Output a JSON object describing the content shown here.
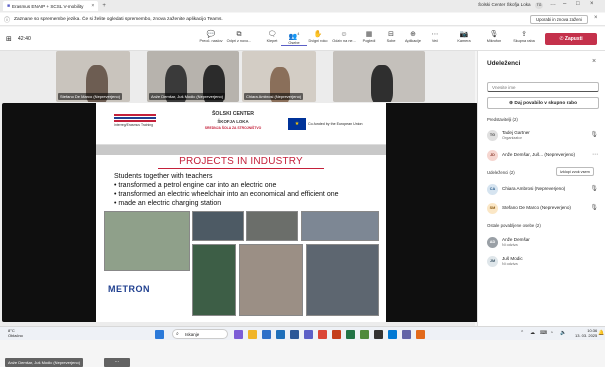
{
  "window": {
    "tab_title": "Erasmus ENAIP + SCSL V-mobility",
    "center_title": "Šolski Center Škofja Loka",
    "user_initials": "TG"
  },
  "notification": {
    "text": "Zaznane so spremembe jezika. Če si želite ogledati spremembo, znova zaženite aplikacijo Teams.",
    "button_label": "Uporabi in znova zaženi"
  },
  "toolbar": {
    "timer": "42:40",
    "buttons": [
      {
        "label": "Preoč. naslov",
        "icon": "chat-icon"
      },
      {
        "label": "Odpri z novo...",
        "icon": "window-icon"
      },
      {
        "label": "Klepet",
        "icon": "chat-bubble-icon"
      },
      {
        "label": "Osebe",
        "icon": "people-icon",
        "count": "4"
      },
      {
        "label": "Dvigni roko",
        "icon": "hand-icon"
      },
      {
        "label": "Odziv na ne...",
        "icon": "emoji-icon"
      },
      {
        "label": "Pogledi",
        "icon": "grid-icon"
      },
      {
        "label": "Sobe",
        "icon": "rooms-icon"
      },
      {
        "label": "Aplikacije",
        "icon": "apps-icon"
      },
      {
        "label": "Več",
        "icon": "more-icon"
      },
      {
        "label": "Kamera",
        "icon": "camera-icon"
      },
      {
        "label": "Mikrofon",
        "icon": "mic-icon"
      },
      {
        "label": "Skupna raba",
        "icon": "share-icon"
      }
    ],
    "leave_label": "Zapusti"
  },
  "videos": [
    {
      "name": "Stefano De Marco (Nepreverjeno)"
    },
    {
      "name": "Anže Demšar, Juš Modic (Nepreverjeno)"
    },
    {
      "name": "Chiara Ambrosi (Nepreverjeno)"
    },
    {
      "name": ""
    }
  ],
  "slide": {
    "left_logo_text": "Interreg/Erasmus Training",
    "center_logo_title": "ŠOLSKI CENTER",
    "center_logo_place": "ŠKOFJA LOKA",
    "center_logo_school": "SREDNJA ŠOLA ZA STROJNIŠTVO",
    "eu_text": "Co-funded by the European Union",
    "title": "PROJECTS IN INDUSTRY",
    "bullets": [
      "Students together with teachers",
      "• transformed a petrol engine car into an electric one",
      "• transformed an electric wheelchair into an economical and efficient one",
      "• made an  electric charging station"
    ],
    "brand_text": "METRON"
  },
  "stage_footer": {
    "participant_label": "Anže Demšar, Juš Modic (Nepreverjeno)"
  },
  "panel": {
    "title": "Udeleženci",
    "search_placeholder": "Vnesite ime",
    "share_label": "Daj povabilo v skupno rabo",
    "sections": {
      "presenters": "Predstavitelji (2)",
      "attendees": "Udeleženci (2)",
      "others": "Ostale povabljene osebe (2)"
    },
    "mute_all_label": "Izklopi zvok vsem",
    "presenters": [
      {
        "initials": "TG",
        "name": "Tadej Gartner",
        "sub": "Organizator"
      },
      {
        "initials": "JD",
        "name": "Anže Demšar, Juš...  (Nepreverjeno)",
        "sub": ""
      }
    ],
    "attendees": [
      {
        "initials": "CA",
        "name": "Chiara Ambrosi (Nepreverjeno)",
        "sub": ""
      },
      {
        "initials": "SM",
        "name": "Stefano De Marco (Nepreverjeno)",
        "sub": ""
      }
    ],
    "others": [
      {
        "initials": "AD",
        "name": "Anže Demšar",
        "sub": "Ni odziva"
      },
      {
        "initials": "JM",
        "name": "Juš Modic",
        "sub": "Ni odziva"
      }
    ]
  },
  "taskbar": {
    "temp": "8°C",
    "weather": "Oblačno",
    "search_placeholder": "Iskanje",
    "time": "10:36",
    "date": "13. 03. 2025"
  },
  "colors": {
    "accent": "#c4314b",
    "brand_red": "#c4203a",
    "brand_blue": "#1f3f8f"
  }
}
